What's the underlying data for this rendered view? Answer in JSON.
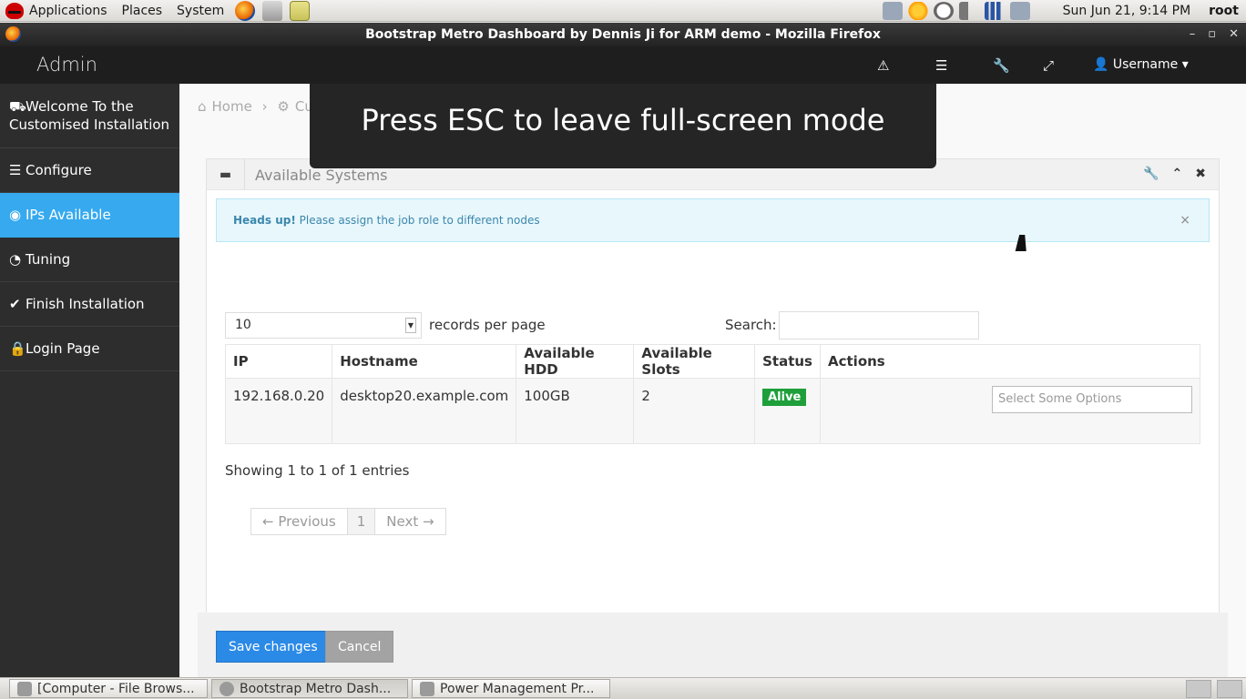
{
  "os_panel": {
    "menus": [
      "Applications",
      "Places",
      "System"
    ],
    "clock": "Sun Jun 21,  9:14 PM",
    "user": "root"
  },
  "window": {
    "title": "Bootstrap Metro Dashboard by Dennis Ji for ARM demo - Mozilla Firefox",
    "controls": [
      "–",
      "▫",
      "✕"
    ]
  },
  "navbar": {
    "brand": "Admin",
    "icons": [
      "warning-icon",
      "list-icon",
      "wrench-icon",
      "fullscreen-icon"
    ],
    "user_label": "Username"
  },
  "sidebar": {
    "items": [
      {
        "label": "Welcome To the Customised Installation",
        "icon": "road-icon"
      },
      {
        "label": "Configure",
        "icon": "align-justify-icon"
      },
      {
        "label": "IPs Available",
        "icon": "eye-icon",
        "active": true
      },
      {
        "label": "Tuning",
        "icon": "dashboard-icon"
      },
      {
        "label": "Finish Installation",
        "icon": "check-icon"
      },
      {
        "label": "Login Page",
        "icon": "lock-icon"
      }
    ]
  },
  "breadcrumb": {
    "home": "Home",
    "current_partial": "Cu"
  },
  "panel": {
    "title": "Available Systems",
    "alert_strong": "Heads up!",
    "alert_text": "Please assign the job role to different nodes"
  },
  "table_controls": {
    "page_length": "10",
    "page_length_suffix": "records per page",
    "search_label": "Search:",
    "search_value": ""
  },
  "table": {
    "headers": [
      "IP",
      "Hostname",
      "Available HDD",
      "Available Slots",
      "Status",
      "Actions"
    ],
    "rows": [
      {
        "ip": "192.168.0.20",
        "hostname": "desktop20.example.com",
        "hdd": "100GB",
        "slots": "2",
        "status": "Alive",
        "actions_placeholder": "Select Some Options"
      }
    ]
  },
  "info_text": "Showing 1 to 1 of 1 entries",
  "pagination": {
    "prev": "← Previous",
    "page": "1",
    "next": "Next →"
  },
  "buttons": {
    "save": "Save changes",
    "cancel": "Cancel"
  },
  "fullscreen_notice": "Press ESC to leave full-screen mode",
  "taskbar": {
    "tasks": [
      "[Computer - File Brows...",
      "Bootstrap Metro Dash...",
      "Power Management Pr..."
    ]
  },
  "colors": {
    "active_nav": "#36a9ef",
    "primary_button": "#2b8ae6",
    "status_alive": "#1f9f3b",
    "navbar_bg": "#1e1e1e",
    "sidebar_bg": "#2d2d2d"
  }
}
